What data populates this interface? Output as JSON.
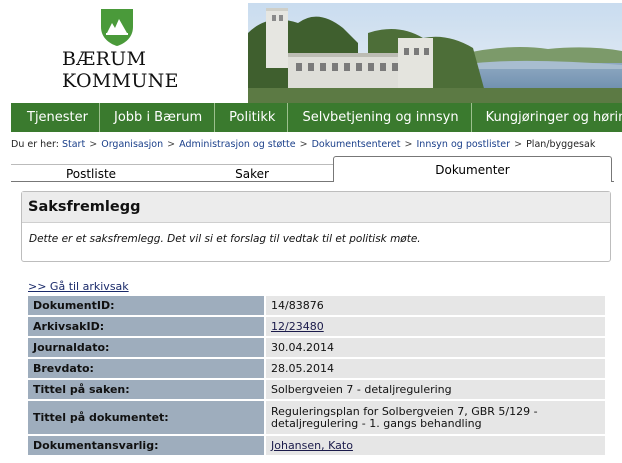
{
  "header": {
    "logo_line1": "BÆRUM",
    "logo_line2": "KOMMUNE"
  },
  "nav": {
    "items": [
      "Tjenester",
      "Jobb i Bærum",
      "Politikk",
      "Selvbetjening og innsyn",
      "Kungjøringer og høring"
    ]
  },
  "breadcrumb": {
    "prefix": "Du er her:",
    "links": [
      "Start",
      "Organisasjon",
      "Administrasjon og støtte",
      "Dokumentsenteret",
      "Innsyn og postlister"
    ],
    "current": "Plan/byggesak",
    "separator": ">"
  },
  "tabs": {
    "postliste": "Postliste",
    "saker": "Saker",
    "dokumenter": "Dokumenter",
    "active": "Dokumenter"
  },
  "infobox": {
    "title": "Saksfremlegg",
    "text": "Dette er et saksfremlegg. Det vil si et forslag til vedtak til et politisk møte."
  },
  "arkiv_link": ">> Gå til arkivsak",
  "meta": {
    "rows": [
      {
        "label": "DokumentID:",
        "value": "14/83876"
      },
      {
        "label": "ArkivsakID:",
        "value": "12/23480"
      },
      {
        "label": "Journaldato:",
        "value": "30.04.2014"
      },
      {
        "label": "Brevdato:",
        "value": "28.05.2014"
      },
      {
        "label": "Tittel på saken:",
        "value": "Solbergveien 7 - detaljregulering"
      },
      {
        "label": "Tittel på dokumentet:",
        "value": "Reguleringsplan for Solbergveien 7, GBR 5/129 - detaljregulering - 1. gangs behandling"
      },
      {
        "label": "Dokumentansvarlig:",
        "value": "Johansen, Kato"
      }
    ]
  },
  "colors": {
    "nav_green": "#3a7a2e",
    "logo_green": "#4a9a3a",
    "label_bg": "#9eadbd",
    "value_bg": "#e6e6e6"
  }
}
